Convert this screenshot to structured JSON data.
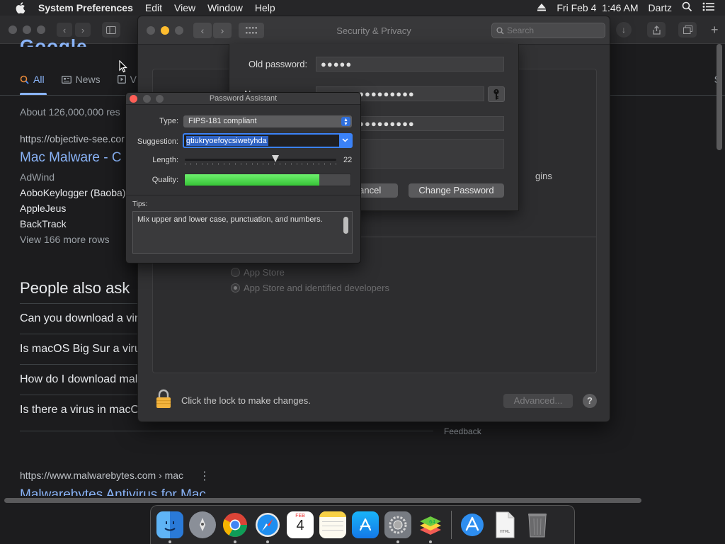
{
  "menubar": {
    "app_name": "System Preferences",
    "menus": [
      "Edit",
      "View",
      "Window",
      "Help"
    ],
    "clock": "Fri Feb 4  1:46 AM",
    "user": "Dartz"
  },
  "browser": {
    "tabs": [
      {
        "label": "All",
        "icon": "search-icon",
        "active": true
      },
      {
        "label": "News",
        "icon": "news-icon",
        "active": false
      },
      {
        "label": "V",
        "icon": "video-icon",
        "active": false
      }
    ],
    "right_fragment": "S",
    "result_count": "About 126,000,000 res",
    "result1": {
      "url": "https://objective-see.cor",
      "title": "Mac Malware - C",
      "subrows": [
        "AdWind",
        "AoboKeylogger (Baoba)",
        "AppleJeus",
        "BackTrack"
      ],
      "more": "View 166 more rows"
    },
    "paa": {
      "heading": "People also ask",
      "questions": [
        "Can you download a vir",
        "Is macOS Big Sur a viru",
        "How do I download mal",
        "Is there a virus in macO"
      ]
    },
    "feedback": "Feedback",
    "result2": {
      "url": "https://www.malwarebytes.com › mac",
      "title": "Malwarebytes Antivirus for Mac"
    }
  },
  "sysprefs": {
    "title": "Security & Privacy",
    "search_placeholder": "Search",
    "partial_label": "gins",
    "radio_options": [
      {
        "label": "App Store",
        "checked": false
      },
      {
        "label": "App Store and identified developers",
        "checked": true
      }
    ],
    "footer_text": "Click the lock to make changes.",
    "advanced_label": "Advanced...",
    "help_label": "?"
  },
  "change_password": {
    "old_label": "Old password:",
    "old_value": "●●●●●",
    "new_label_partial": "N",
    "new_value": "●●●●●●●●●●●●●●●",
    "verify_value": "●●●●●●●●●●●●●●●",
    "cancel_label": "Cancel",
    "change_label": "Change Password"
  },
  "password_assistant": {
    "title": "Password Assistant",
    "type_label": "Type:",
    "type_value": "FIPS-181 compliant",
    "suggestion_label": "Suggestion:",
    "suggestion_value": "gtiukryoefoycsiwetyhda",
    "length_label": "Length:",
    "length_value": "22",
    "length_fraction": 0.6,
    "quality_label": "Quality:",
    "quality_fraction": 0.81,
    "tips_label": "Tips:",
    "tips_text": "Mix upper and lower case, punctuation, and numbers."
  },
  "dock": {
    "apps": [
      {
        "name": "finder-icon",
        "running": true
      },
      {
        "name": "launchpad-icon",
        "running": false
      },
      {
        "name": "chrome-icon",
        "running": true
      },
      {
        "name": "safari-icon",
        "running": true
      },
      {
        "name": "calendar-icon",
        "running": false,
        "month": "FEB",
        "day": "4"
      },
      {
        "name": "notes-icon",
        "running": false
      },
      {
        "name": "app-store-icon",
        "running": false
      },
      {
        "name": "system-preferences-icon",
        "running": true
      },
      {
        "name": "bluestacks-icon",
        "running": true
      },
      {
        "name": "downloads-icon",
        "running": false
      },
      {
        "name": "document-icon",
        "running": false
      },
      {
        "name": "trash-icon",
        "running": false
      }
    ]
  },
  "colors": {
    "accent_blue": "#3b82f7",
    "link_blue": "#8ab4f8",
    "quality_green": "#4cd64c",
    "close_red": "#ff5f57",
    "minimize_yellow": "#febc2e"
  }
}
